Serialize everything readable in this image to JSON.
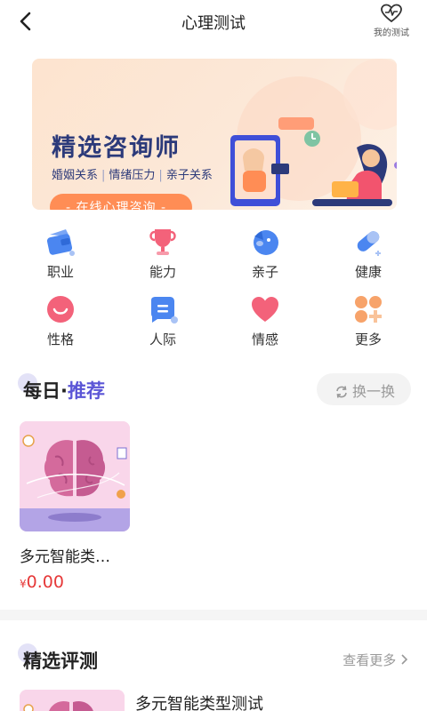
{
  "header": {
    "title": "心理测试",
    "my_tests_label": "我的测试"
  },
  "banner": {
    "title": "精选咨询师",
    "tags": [
      "婚姻关系",
      "情绪压力",
      "亲子关系"
    ],
    "cta": "- 在线心理咨询 -"
  },
  "categories": [
    {
      "label": "职业",
      "icon": "wallet-icon",
      "color": "#4b86f0"
    },
    {
      "label": "能力",
      "icon": "trophy-icon",
      "color": "#f3627a"
    },
    {
      "label": "亲子",
      "icon": "dog-icon",
      "color": "#4b86f0"
    },
    {
      "label": "健康",
      "icon": "pill-icon",
      "color": "#4b86f0"
    },
    {
      "label": "性格",
      "icon": "smile-icon",
      "color": "#f3627a"
    },
    {
      "label": "人际",
      "icon": "chat-icon",
      "color": "#4b86f0"
    },
    {
      "label": "情感",
      "icon": "heart-icon",
      "color": "#f3627a"
    },
    {
      "label": "更多",
      "icon": "more-icon",
      "color": "#f7a36a"
    }
  ],
  "daily": {
    "title_prefix": "每日·",
    "title_accent": "推荐",
    "swap_label": "换一换",
    "item": {
      "name": "多元智能类…",
      "currency": "¥",
      "price": "0.00"
    }
  },
  "featured": {
    "title": "精选评测",
    "see_more": "查看更多",
    "item_name": "多元智能类型测试"
  },
  "colors": {
    "accent": "#5b55d6",
    "price": "#e63838",
    "cta": "#ff8d55"
  }
}
